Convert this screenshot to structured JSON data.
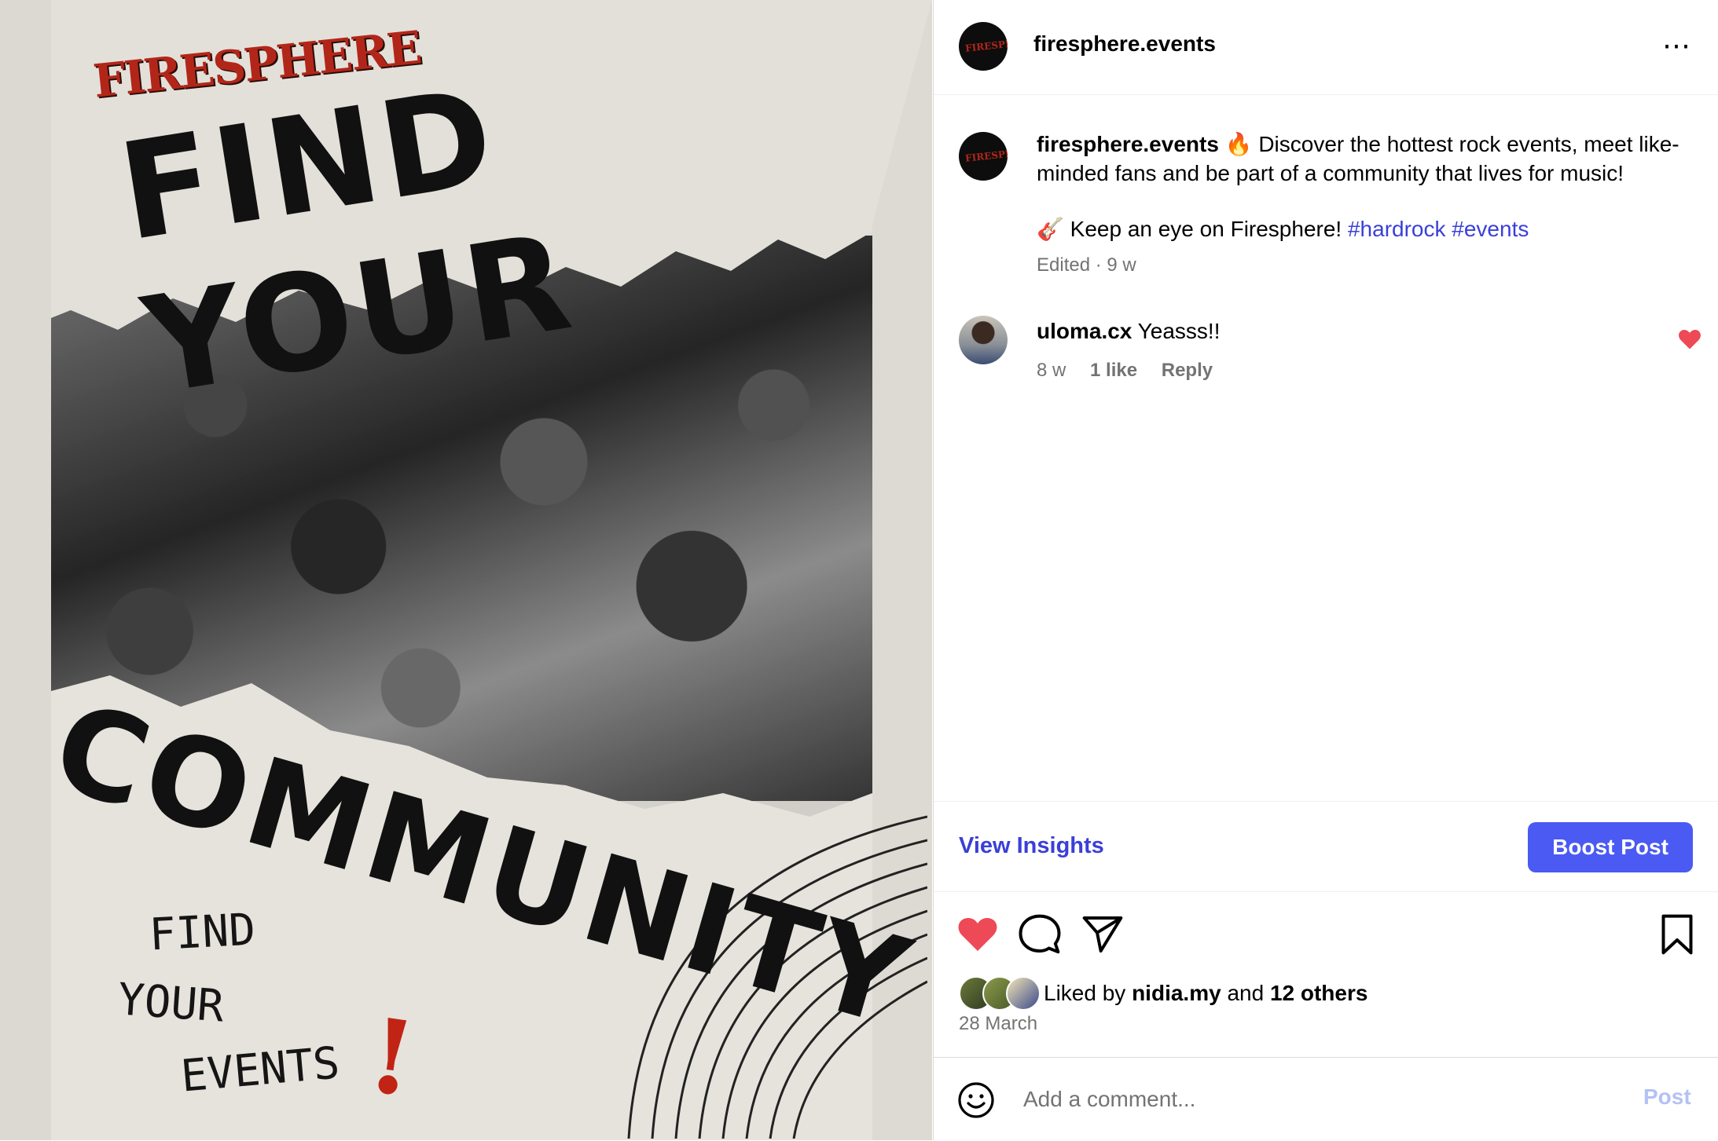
{
  "poster": {
    "logo_text": "FIRESPHERE",
    "headline_top": "FIND YOUR",
    "headline_bottom": "COMMUNITY",
    "small_line_1": "FIND",
    "small_line_2": "YOUR",
    "small_line_3": "EVENTS",
    "exclaim": "!",
    "accent_red": "#b22619"
  },
  "header": {
    "username": "firesphere.events",
    "more_icon": "⋯",
    "avatar_icon": "firesphere-logo-avatar"
  },
  "caption": {
    "username": "firesphere.events",
    "line1": " 🔥 Discover the hottest rock events, meet like-minded fans and be part of a community that lives for music!",
    "line2_prefix": "🎸 Keep an eye on Firesphere! ",
    "hashtag1": "#hardrock",
    "hashtag2": "#events",
    "meta": "Edited · 9 w"
  },
  "comment": {
    "username": "uloma.cx",
    "text": " Yeasss!!",
    "time": "8 w",
    "likes": "1 like",
    "reply": "Reply",
    "liked_color": "#ed4956"
  },
  "insights": {
    "view_label": "View Insights",
    "boost_label": "Boost Post",
    "link_color": "#3a3fd8",
    "button_color": "#4a5af2"
  },
  "actions": {
    "like_icon": "heart-filled",
    "comment_icon": "speech-bubble",
    "share_icon": "paper-plane",
    "save_icon": "bookmark"
  },
  "likes": {
    "prefix": "Liked by ",
    "user": "nidia.my",
    "middle": " and ",
    "others": "12 others",
    "date": "28 March"
  },
  "comment_box": {
    "placeholder": "Add a comment...",
    "post_label": "Post"
  }
}
